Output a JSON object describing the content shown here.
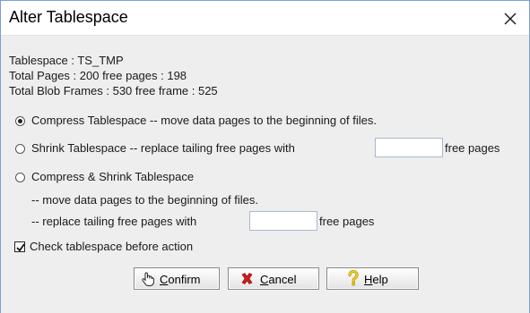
{
  "window": {
    "title": "Alter Tablespace"
  },
  "info": {
    "tablespace_line": "Tablespace : TS_TMP",
    "pages_line": "Total Pages : 200   free pages : 198",
    "blob_line": "Total Blob Frames : 530   free frame : 525"
  },
  "options": {
    "selected": "compress",
    "compress": {
      "label": "Compress Tablespace",
      "description": " -- move data pages to the beginning of files."
    },
    "shrink": {
      "label": "Shrink Tablespace",
      "description": " -- replace tailing free pages with",
      "suffix": "free pages",
      "value": ""
    },
    "compress_shrink": {
      "label": "Compress & Shrink Tablespace",
      "line1": "-- move data pages to the beginning of files.",
      "line2": "-- replace tailing free pages with",
      "suffix": "free pages",
      "value": ""
    }
  },
  "check_before": {
    "label": "Check tablespace before action",
    "checked": true
  },
  "buttons": {
    "confirm": {
      "mnemonic": "C",
      "rest": "onfirm"
    },
    "cancel": {
      "mnemonic": "C",
      "rest": "ancel"
    },
    "help": {
      "mnemonic": "H",
      "rest": "elp"
    }
  },
  "colors": {
    "title_bar": "#ffffff",
    "body": "#eeeeee",
    "cancel_icon": "#d11b1b",
    "help_icon": "#e8c81a"
  },
  "icons": {
    "close": "close-icon",
    "confirm": "hand-pointer-icon",
    "cancel": "red-x-icon",
    "help": "question-icon"
  }
}
